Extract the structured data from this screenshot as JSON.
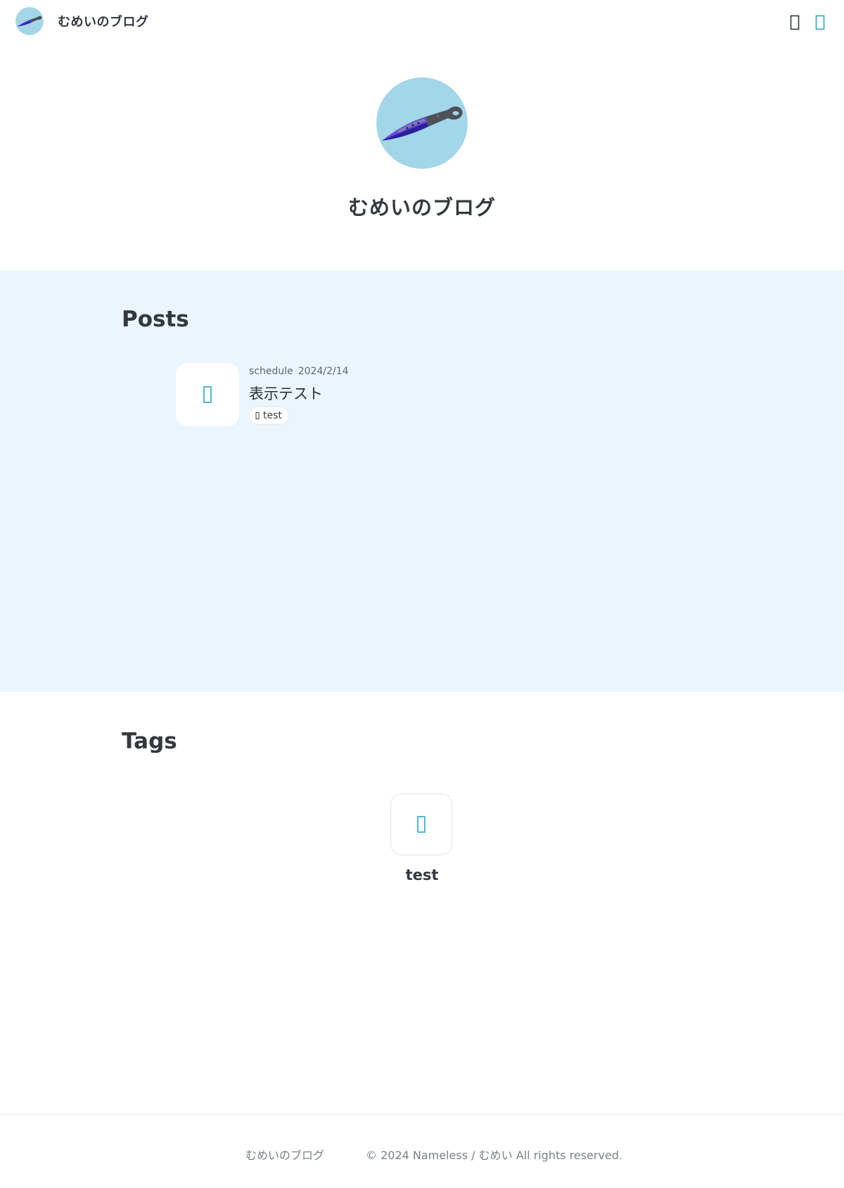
{
  "header": {
    "site_title": "むめいのブログ",
    "icons": [
      "search-icon",
      "theme-toggle-icon"
    ]
  },
  "hero": {
    "title": "むめいのブログ",
    "avatar": "knife-avatar"
  },
  "posts": {
    "heading": "Posts",
    "items": [
      {
        "category": "schedule",
        "date": "2024/2/14",
        "title": "表示テスト",
        "thumb_icon": "document-icon",
        "tags": [
          {
            "label": "test",
            "icon": "tag-icon"
          }
        ]
      }
    ]
  },
  "tags": {
    "heading": "Tags",
    "items": [
      {
        "label": "test",
        "icon": "tag-icon"
      }
    ]
  },
  "footer": {
    "site_name": "むめいのブログ",
    "copyright": "© 2024 Nameless / むめい All rights reserved."
  },
  "colors": {
    "accent": "#2aa6c7",
    "avatar_bg": "#a2d6e8",
    "posts_bg": "#eaf5fe",
    "text": "#33393f"
  }
}
